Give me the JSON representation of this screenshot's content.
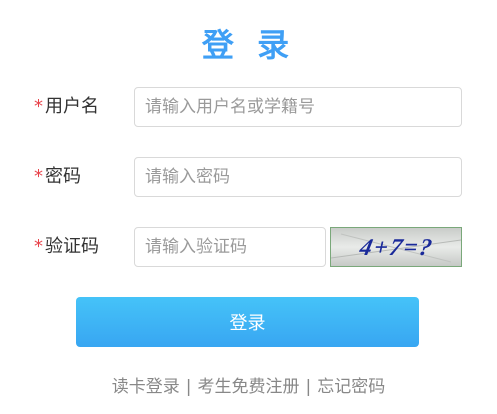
{
  "title": "登 录",
  "form": {
    "required_mark": "*",
    "username": {
      "label": "用户名",
      "placeholder": "请输入用户名或学籍号",
      "value": ""
    },
    "password": {
      "label": "密码",
      "placeholder": "请输入密码",
      "value": ""
    },
    "captcha": {
      "label": "验证码",
      "placeholder": "请输入验证码",
      "value": "",
      "image_text": "4+7=?"
    },
    "submit_label": "登录"
  },
  "footer": {
    "links": [
      "读卡登录",
      "考生免费注册",
      "忘记密码"
    ],
    "separator": "|"
  },
  "colors": {
    "accent": "#3f9ff5",
    "required": "#e8424a",
    "button_top": "#45c3f8",
    "button_bottom": "#38a6f2",
    "footer_text": "#888888"
  }
}
